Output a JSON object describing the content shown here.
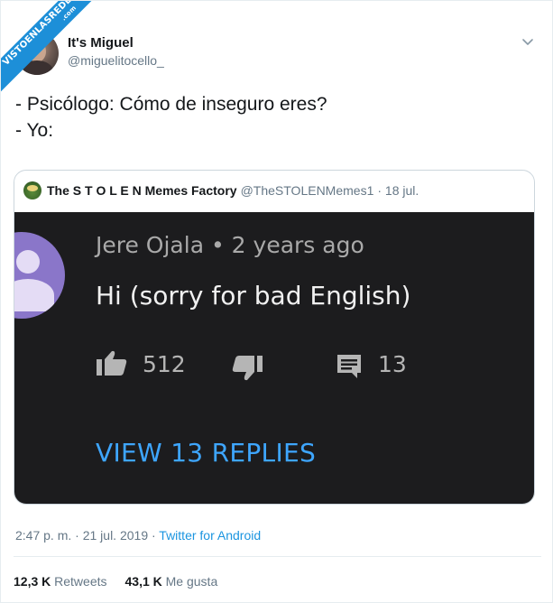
{
  "watermark": {
    "text": "VISTOENLASREDES",
    "suffix": ".com"
  },
  "author": {
    "name": "It's Miguel",
    "handle": "@miguelitocello_"
  },
  "tweet": {
    "lines": [
      "- Psicólogo: Cómo de inseguro eres?",
      "- Yo:"
    ]
  },
  "quoted": {
    "name": "The S T O L E N Memes Factory",
    "handle": "@TheSTOLENMemes1",
    "date": "· 18 jul.",
    "image": {
      "username": "Jere Ojala",
      "age": "• 2 years ago",
      "comment": "Hi (sorry for bad English)",
      "likes": "512",
      "replies": "13",
      "view_replies": "VIEW 13 REPLIES"
    }
  },
  "meta": {
    "time": "2:47 p. m.",
    "date": "· 21 jul. 2019 ·",
    "source": "Twitter for Android"
  },
  "stats": {
    "retweets_value": "12,3 K",
    "retweets_label": "Retweets",
    "likes_value": "43,1 K",
    "likes_label": "Me gusta"
  },
  "colors": {
    "link": "#1b95e0",
    "yt_blue": "#3ea6ff",
    "ribbon": "#1d8fd8"
  }
}
